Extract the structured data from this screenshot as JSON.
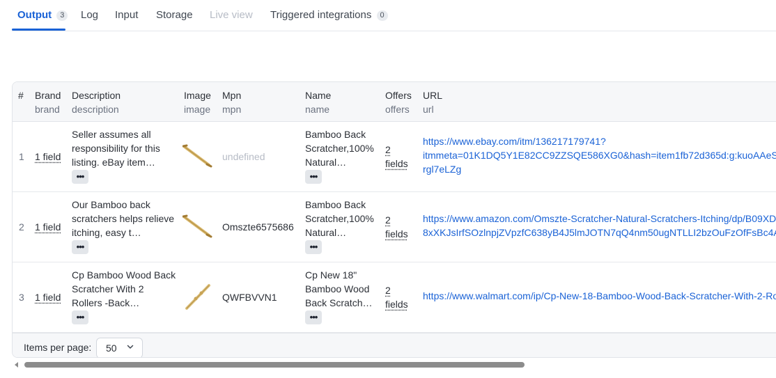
{
  "tabs": [
    {
      "label": "Output",
      "count": "3",
      "state": "active"
    },
    {
      "label": "Log"
    },
    {
      "label": "Input"
    },
    {
      "label": "Storage"
    },
    {
      "label": "Live view",
      "state": "disabled"
    },
    {
      "label": "Triggered integrations",
      "count": "0"
    }
  ],
  "table": {
    "columns": [
      {
        "label": "#",
        "key": ""
      },
      {
        "label": "Brand",
        "key": "brand"
      },
      {
        "label": "Description",
        "key": "description"
      },
      {
        "label": "Image",
        "key": "image"
      },
      {
        "label": "Mpn",
        "key": "mpn"
      },
      {
        "label": "Name",
        "key": "name"
      },
      {
        "label": "Offers",
        "key": "offers"
      },
      {
        "label": "URL",
        "key": "url"
      }
    ],
    "rows": [
      {
        "index": "1",
        "brand": "1 field",
        "description": "Seller assumes all responsibility for this listing. eBay item…",
        "mpn": "undefined",
        "name": "Bamboo Back Scratcher,100% Natural…",
        "offers_count": "2",
        "offers_label": "fields",
        "url_line1": "https://www.ebay.com/itm/136217179741?",
        "url_line2": "itmmeta=01K1DQ5Y1E82CC9ZZSQE586XG0&hash=item1fb72d365d:g:kuoAAeS",
        "url_line3": "rgl7eLZg"
      },
      {
        "index": "2",
        "brand": "1 field",
        "description": "Our Bamboo back scratchers helps relieve itching, easy t…",
        "mpn": "Omszte6575686",
        "name": "Bamboo Back Scratcher,100% Natural…",
        "offers_count": "2",
        "offers_label": "fields",
        "url_line1": "https://www.amazon.com/Omszte-Scratcher-Natural-Scratchers-Itching/dp/B09XD",
        "url_line2": "8xXKJsIrfSOzlnpjZVpzfC638yB4J5lmJOTN7qQ4nm50ugNTLLI2bzOuFzOfFsBc4A",
        "url_line3": ""
      },
      {
        "index": "3",
        "brand": "1 field",
        "description": "Cp Bamboo Wood Back Scratcher With 2 Rollers -Back…",
        "mpn": "QWFBVVN1",
        "name": "Cp New 18\" Bamboo Wood Back Scratch…",
        "offers_count": "2",
        "offers_label": "fields",
        "url_line1": "",
        "url_line2": "https://www.walmart.com/ip/Cp-New-18-Bamboo-Wood-Back-Scratcher-With-2-Ro",
        "url_line3": ""
      }
    ],
    "more_glyph": "•••"
  },
  "pagination": {
    "items_per_page_label": "Items per page:",
    "items_per_page_value": "50"
  },
  "colors": {
    "accent": "#1a62d6",
    "muted": "#b7bcc6",
    "header_bg": "#f6f7f9"
  },
  "icons": {
    "row_image": "bamboo-back-scratcher-image",
    "select_chevron": "chevron-down-icon",
    "scroll_left": "scroll-left-arrow-icon"
  }
}
